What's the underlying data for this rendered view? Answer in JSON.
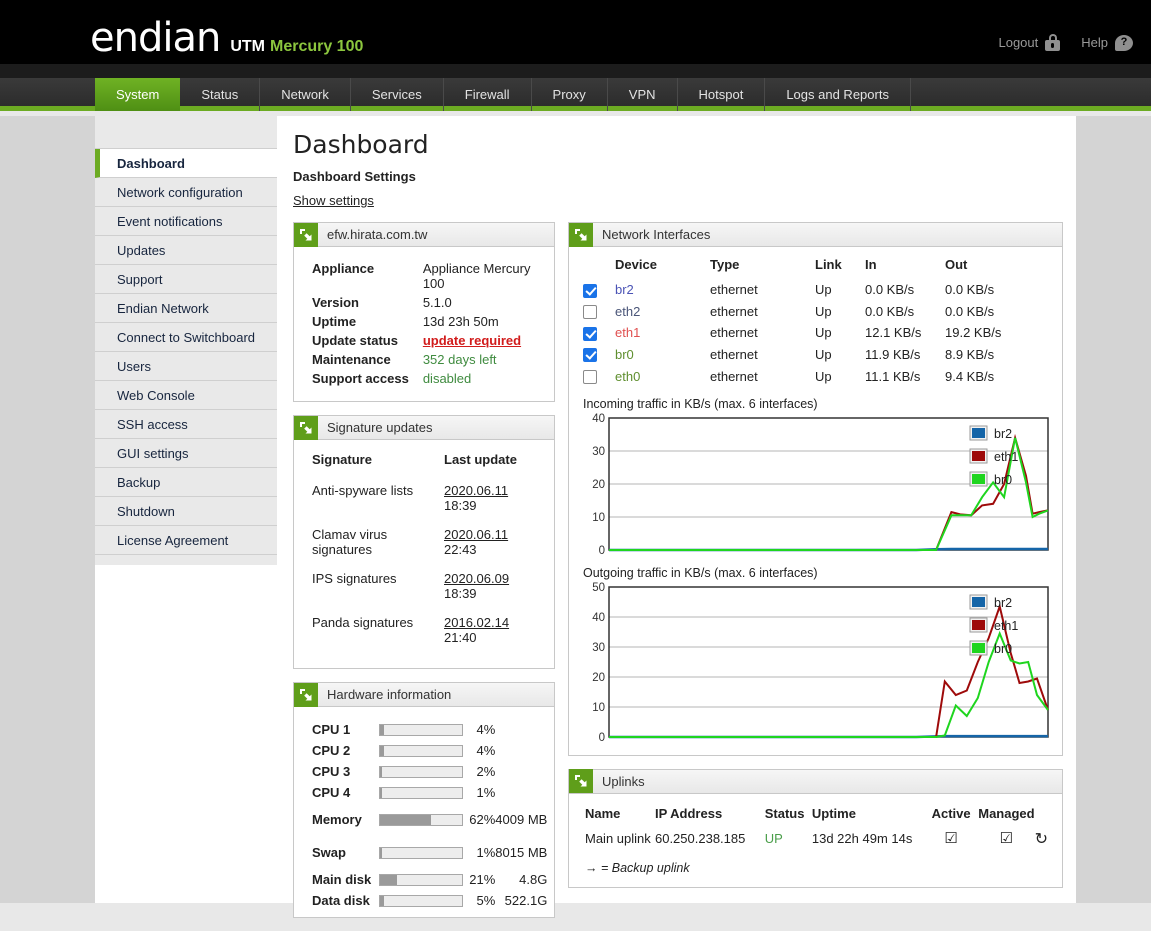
{
  "header": {
    "brand": "endian",
    "product_prefix": "UTM",
    "product_model": "Mercury 100",
    "logout_label": "Logout",
    "help_label": "Help",
    "lock_icon": "lock-icon",
    "help_icon": "help-bubble-icon",
    "accent_green": "#8cc63e"
  },
  "nav": {
    "tabs": [
      {
        "label": "System",
        "active": true
      },
      {
        "label": "Status",
        "active": false
      },
      {
        "label": "Network",
        "active": false
      },
      {
        "label": "Services",
        "active": false
      },
      {
        "label": "Firewall",
        "active": false
      },
      {
        "label": "Proxy",
        "active": false
      },
      {
        "label": "VPN",
        "active": false
      },
      {
        "label": "Hotspot",
        "active": false
      },
      {
        "label": "Logs and Reports",
        "active": false
      }
    ],
    "active_bg": "#6cab22"
  },
  "sidebar": {
    "items": [
      {
        "label": "Dashboard",
        "active": true
      },
      {
        "label": "Network configuration",
        "active": false
      },
      {
        "label": "Event notifications",
        "active": false
      },
      {
        "label": "Updates",
        "active": false
      },
      {
        "label": "Support",
        "active": false
      },
      {
        "label": "Endian Network",
        "active": false
      },
      {
        "label": "Connect to Switchboard",
        "active": false
      },
      {
        "label": "Users",
        "active": false
      },
      {
        "label": "Web Console",
        "active": false
      },
      {
        "label": "SSH access",
        "active": false
      },
      {
        "label": "GUI settings",
        "active": false
      },
      {
        "label": "Backup",
        "active": false
      },
      {
        "label": "Shutdown",
        "active": false
      },
      {
        "label": "License Agreement",
        "active": false
      }
    ]
  },
  "page": {
    "title": "Dashboard",
    "settings_heading": "Dashboard Settings",
    "show_settings_link": "Show settings"
  },
  "appliance_panel": {
    "title": "efw.hirata.com.tw",
    "rows": [
      {
        "key": "Appliance",
        "value": "Appliance Mercury 100",
        "style": "plain"
      },
      {
        "key": "Version",
        "value": "5.1.0",
        "style": "plain"
      },
      {
        "key": "Uptime",
        "value": "13d 23h 50m",
        "style": "plain"
      },
      {
        "key": "Update status",
        "value": "update required",
        "style": "red-link"
      },
      {
        "key": "Maintenance",
        "value": "352 days left",
        "style": "green"
      },
      {
        "key": "Support access",
        "value": "disabled",
        "style": "green"
      }
    ]
  },
  "signature_panel": {
    "title": "Signature updates",
    "columns": [
      "Signature",
      "Last update"
    ],
    "rows": [
      {
        "name": "Anti-spyware lists",
        "date": "2020.06.11",
        "time": "18:39"
      },
      {
        "name": "Clamav virus signatures",
        "date": "2020.06.11",
        "time": "22:43"
      },
      {
        "name": "IPS signatures",
        "date": "2020.06.09",
        "time": "18:39"
      },
      {
        "name": "Panda signatures",
        "date": "2016.02.14",
        "time": "21:40"
      }
    ]
  },
  "hardware_panel": {
    "title": "Hardware information",
    "rows": [
      {
        "label": "CPU 1",
        "percent": 4,
        "percent_label": "4%",
        "size": "",
        "spaced": false
      },
      {
        "label": "CPU 2",
        "percent": 4,
        "percent_label": "4%",
        "size": "",
        "spaced": false
      },
      {
        "label": "CPU 3",
        "percent": 2,
        "percent_label": "2%",
        "size": "",
        "spaced": false
      },
      {
        "label": "CPU 4",
        "percent": 1,
        "percent_label": "1%",
        "size": "",
        "spaced": false
      },
      {
        "label": "Memory",
        "percent": 62,
        "percent_label": "62%",
        "size": "4009 MB",
        "spaced": true
      },
      {
        "label": "Swap",
        "percent": 1,
        "percent_label": "1%",
        "size": "8015 MB",
        "spaced": true
      },
      {
        "label": "Main disk",
        "percent": 21,
        "percent_label": "21%",
        "size": "4.8G",
        "spaced": false
      },
      {
        "label": "Data disk",
        "percent": 5,
        "percent_label": "5%",
        "size": "522.1G",
        "spaced": false
      }
    ]
  },
  "network_panel": {
    "title": "Network Interfaces",
    "columns": [
      "",
      "Device",
      "Type",
      "Link",
      "In",
      "Out"
    ],
    "rows": [
      {
        "checked": true,
        "device": "br2",
        "device_color": "#4a53b5",
        "type": "ethernet",
        "link": "Up",
        "in": "0.0 KB/s",
        "out": "0.0 KB/s"
      },
      {
        "checked": false,
        "device": "eth2",
        "device_color": "#4a5578",
        "type": "ethernet",
        "link": "Up",
        "in": "0.0 KB/s",
        "out": "0.0 KB/s"
      },
      {
        "checked": true,
        "device": "eth1",
        "device_color": "#e05050",
        "type": "ethernet",
        "link": "Up",
        "in": "12.1 KB/s",
        "out": "19.2 KB/s"
      },
      {
        "checked": true,
        "device": "br0",
        "device_color": "#5f8f2f",
        "type": "ethernet",
        "link": "Up",
        "in": "11.9 KB/s",
        "out": "8.9 KB/s"
      },
      {
        "checked": false,
        "device": "eth0",
        "device_color": "#5f8f2f",
        "type": "ethernet",
        "link": "Up",
        "in": "11.1 KB/s",
        "out": "9.4 KB/s"
      }
    ]
  },
  "chart_data": [
    {
      "type": "line",
      "title": "Incoming traffic in KB/s (max. 6 interfaces)",
      "xlabel": "",
      "ylabel": "KB/s",
      "ylim": [
        0,
        40
      ],
      "yticks": [
        0,
        10,
        20,
        30,
        40
      ],
      "grid": true,
      "legend_position": "top-right",
      "legend": [
        {
          "name": "br2",
          "color": "#1565a8"
        },
        {
          "name": "eth1",
          "color": "#9e0a0a"
        },
        {
          "name": "br0",
          "color": "#1fd51f"
        }
      ],
      "x": [
        0,
        0.1,
        0.2,
        0.3,
        0.4,
        0.5,
        0.6,
        0.65,
        0.7,
        0.745,
        0.78,
        0.8,
        0.825,
        0.85,
        0.875,
        0.9,
        0.925,
        0.95,
        0.965,
        0.98,
        1.0
      ],
      "series": [
        {
          "name": "br2",
          "color": "#1565a8",
          "values": [
            0,
            0,
            0,
            0,
            0,
            0,
            0,
            0,
            0,
            0.2,
            0.3,
            0.3,
            0.3,
            0.3,
            0.3,
            0.3,
            0.3,
            0.3,
            0.3,
            0.3,
            0.3
          ]
        },
        {
          "name": "eth1",
          "color": "#9e0a0a",
          "values": [
            0,
            0,
            0,
            0,
            0,
            0,
            0,
            0,
            0,
            0,
            11.5,
            10.8,
            10.5,
            13.5,
            14.0,
            20.0,
            34.0,
            22.5,
            11.0,
            11.5,
            12.0
          ]
        },
        {
          "name": "br0",
          "color": "#1fd51f",
          "values": [
            0,
            0,
            0,
            0,
            0,
            0,
            0,
            0,
            0,
            0,
            10.5,
            10.5,
            10.5,
            16.0,
            20.5,
            16.0,
            34.0,
            20.5,
            10.0,
            11.0,
            12.0
          ]
        }
      ]
    },
    {
      "type": "line",
      "title": "Outgoing traffic in KB/s (max. 6 interfaces)",
      "xlabel": "",
      "ylabel": "KB/s",
      "ylim": [
        0,
        50
      ],
      "yticks": [
        0,
        10,
        20,
        30,
        40,
        50
      ],
      "grid": true,
      "legend_position": "top-right",
      "legend": [
        {
          "name": "br2",
          "color": "#1565a8"
        },
        {
          "name": "eth1",
          "color": "#9e0a0a"
        },
        {
          "name": "br0",
          "color": "#1fd51f"
        }
      ],
      "x": [
        0,
        0.1,
        0.2,
        0.3,
        0.4,
        0.5,
        0.6,
        0.65,
        0.7,
        0.745,
        0.765,
        0.79,
        0.815,
        0.84,
        0.865,
        0.89,
        0.915,
        0.935,
        0.955,
        0.975,
        1.0
      ],
      "series": [
        {
          "name": "br2",
          "color": "#1565a8",
          "values": [
            0,
            0,
            0,
            0,
            0,
            0,
            0,
            0,
            0,
            0.2,
            0.3,
            0.3,
            0.3,
            0.3,
            0.3,
            0.3,
            0.3,
            0.3,
            0.3,
            0.3,
            0.3
          ]
        },
        {
          "name": "eth1",
          "color": "#9e0a0a",
          "values": [
            0,
            0,
            0,
            0,
            0,
            0,
            0,
            0,
            0,
            0,
            18.5,
            14.0,
            15.5,
            25.0,
            33.0,
            43.5,
            28.0,
            18.0,
            18.5,
            19.5,
            9.0
          ]
        },
        {
          "name": "br0",
          "color": "#1fd51f",
          "values": [
            0,
            0,
            0,
            0,
            0,
            0,
            0,
            0,
            0,
            0,
            0.5,
            10.5,
            7.0,
            13.0,
            25.0,
            34.5,
            25.5,
            24.5,
            25.0,
            14.0,
            9.0
          ]
        }
      ]
    }
  ],
  "uplinks_panel": {
    "title": "Uplinks",
    "columns": [
      "Name",
      "IP Address",
      "Status",
      "Uptime",
      "Active",
      "Managed"
    ],
    "rows": [
      {
        "name": "Main uplink",
        "ip": "60.250.238.185",
        "status": "UP",
        "uptime": "13d 22h 49m 14s",
        "active": "☑",
        "managed": "☑",
        "refresh_icon": "refresh-icon"
      }
    ],
    "footnote": "→ = Backup uplink"
  }
}
